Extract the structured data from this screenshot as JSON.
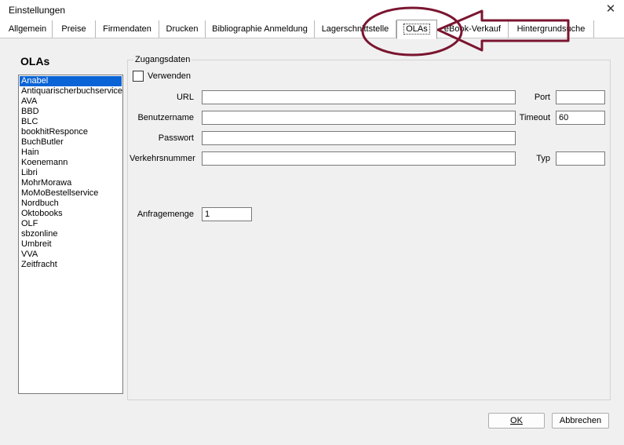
{
  "window": {
    "title": "Einstellungen",
    "close_glyph": "✕"
  },
  "tabs": [
    {
      "label": "Allgemein"
    },
    {
      "label": "Preise"
    },
    {
      "label": "Firmendaten"
    },
    {
      "label": "Drucken"
    },
    {
      "label": "Bibliographie Anmeldung"
    },
    {
      "label": "Lagerschnittstelle"
    },
    {
      "label": "OLAs"
    },
    {
      "label": "eBook-Verkauf"
    },
    {
      "label": "Hintergrundsuche"
    }
  ],
  "active_tab": "OLAs",
  "sidebar": {
    "heading": "OLAs",
    "items": [
      "Anabel",
      "Antiquarischerbuchservice",
      "AVA",
      "BBD",
      "BLC",
      "bookhitResponce",
      "BuchButler",
      "Hain",
      "Koenemann",
      "Libri",
      "MohrMorawa",
      "MoMoBestellservice",
      "Nordbuch",
      "Oktobooks",
      "OLF",
      "sbzonline",
      "Umbreit",
      "VVA",
      "Zeitfracht"
    ],
    "selected": "Anabel"
  },
  "group": {
    "title": "Zugangsdaten",
    "use_label": "Verwenden",
    "url_label": "URL",
    "url_value": "",
    "port_label": "Port",
    "port_value": "",
    "user_label": "Benutzername",
    "user_value": "",
    "timeout_label": "Timeout",
    "timeout_value": "60",
    "pass_label": "Passwort",
    "pass_value": "",
    "traffic_label": "Verkehrsnummer",
    "traffic_value": "",
    "type_label": "Typ",
    "type_value": "",
    "request_label": "Anfragemenge",
    "request_value": "1"
  },
  "buttons": {
    "ok": "OK",
    "cancel": "Abbrechen"
  },
  "annotation_color": "#7a1530"
}
